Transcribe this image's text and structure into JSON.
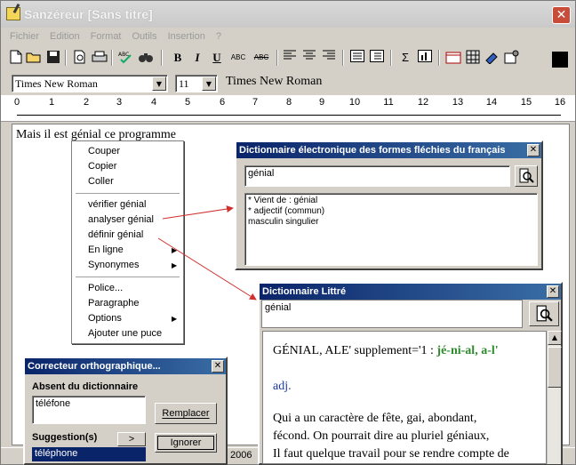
{
  "window": {
    "title": "Sanzéreur [Sans titre]"
  },
  "menu": [
    "Fichier",
    "Edition",
    "Format",
    "Outils",
    "Insertion",
    "?"
  ],
  "toolbar": {
    "bold": "B",
    "italic": "I",
    "underline": "U",
    "smallcaps": "ABC",
    "strike": "ABC",
    "sigma": "Σ"
  },
  "font": {
    "name": "Times New Roman",
    "size": "11",
    "preview": "Times New Roman"
  },
  "ruler": [
    "0",
    "1",
    "2",
    "3",
    "4",
    "5",
    "6",
    "7",
    "8",
    "9",
    "10",
    "11",
    "12",
    "13",
    "14",
    "15",
    "16"
  ],
  "document": {
    "text": "Mais il est génial ce programme"
  },
  "context_menu": {
    "items": [
      "Couper",
      "Copier",
      "Coller",
      "vérifier génial",
      "analyser génial",
      "définir génial",
      "En ligne",
      "Synonymes",
      "Police...",
      "Paragraphe",
      "Options",
      "Ajouter une puce"
    ]
  },
  "dict_electro": {
    "title": "Dictionnaire électronique des formes fléchies du français",
    "query": "génial",
    "results": [
      "* Vient de : génial",
      "* adjectif (commun)",
      "masculin singulier"
    ]
  },
  "dict_littre": {
    "title": "Dictionnaire Littré",
    "query": "génial",
    "headword": "GÉNIAL, ALE' supplement='1 : ",
    "pronunciation": "jé-ni-al, a-l'",
    "pos": "adj.",
    "lines": [
      "Qui a un caractère de fête, gai, abondant,",
      "fécond. On pourrait dire au pluriel géniaux,",
      "Il faut quelque travail pour se rendre compte de"
    ]
  },
  "spell": {
    "title": "Correcteur orthographique...",
    "absent_label": "Absent du dictionnaire",
    "word": "téléfone",
    "replace_btn": "Remplacer",
    "suggestions_label": "Suggestion(s)",
    "suggestions_arrow": ">",
    "ignore_btn": "Ignorer",
    "suggestion_selected": "téléphone"
  },
  "status": {
    "year": "2006"
  },
  "colors": {
    "title_blue": "#0a246a",
    "selection": "#0a246a",
    "pron_green": "#2f8a2f",
    "pos_blue": "#1a3aa0",
    "arrow_red": "#d03030"
  }
}
